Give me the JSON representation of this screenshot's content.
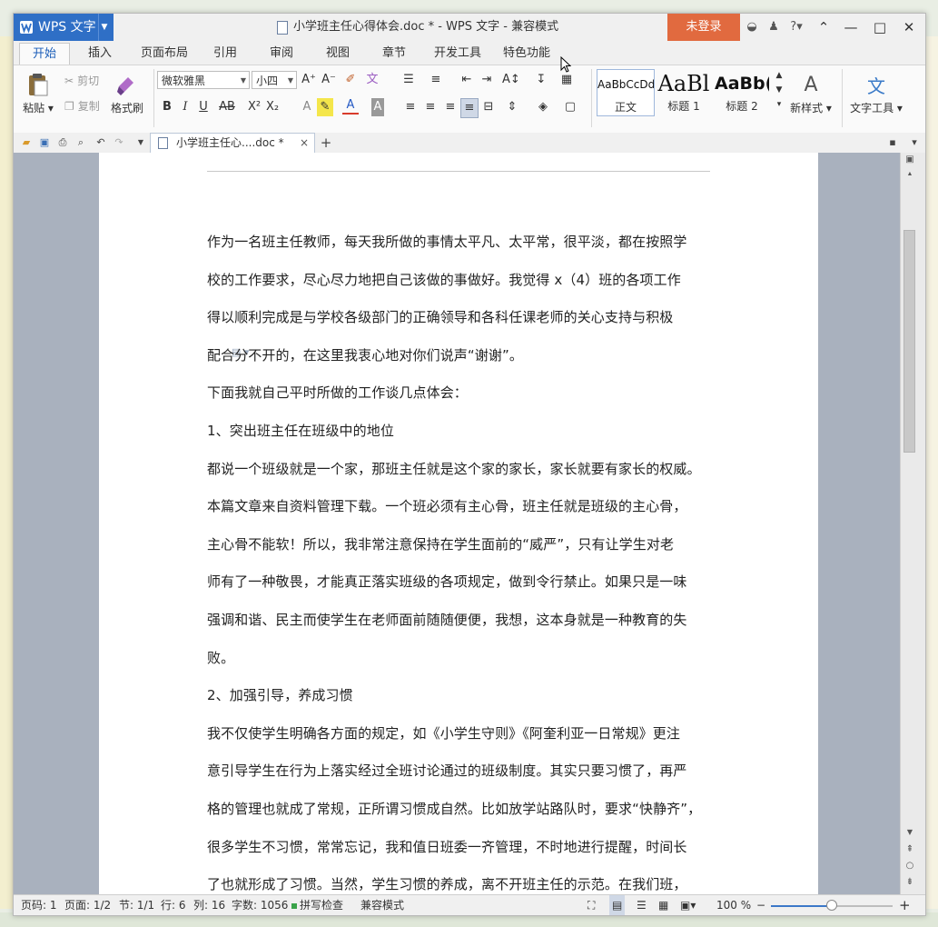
{
  "window": {
    "app_name": "WPS 文字",
    "title": "小学班主任心得体会.doc * - WPS 文字 - 兼容模式",
    "login": "未登录",
    "controls": [
      "?",
      "—",
      "□",
      "✕"
    ]
  },
  "tabs": [
    {
      "label": "开始",
      "active": true
    },
    {
      "label": "插入"
    },
    {
      "label": "页面布局"
    },
    {
      "label": "引用"
    },
    {
      "label": "审阅"
    },
    {
      "label": "视图"
    },
    {
      "label": "章节"
    },
    {
      "label": "开发工具"
    },
    {
      "label": "特色功能"
    }
  ],
  "ribbon": {
    "paste": "粘贴",
    "cut": "剪切",
    "copy": "复制",
    "format_painter": "格式刷",
    "font_name": "微软雅黑",
    "font_size": "小四",
    "styles": [
      {
        "sample": "AaBbCcDd",
        "label": "正文"
      },
      {
        "sample": "AaBl",
        "label": "标题 1"
      },
      {
        "sample": "AaBb(",
        "label": "标题 2"
      }
    ],
    "new_style": "新样式",
    "text_tools": "文字工具"
  },
  "doc_tab": {
    "label": "小学班主任心....doc *"
  },
  "document": {
    "paragraphs": [
      [
        "作为一名班主任教师，每天我所做的事情太平凡、太平常，很平淡，都在按照学",
        "校的工作要求，尽心尽力地把自己该做的事做好。我觉得 x（4）班的各项工作",
        "得以顺利完成是与学校各级部门的正确领导和各科任课老师的关心支持与积极",
        "配合分不开的，在这里我衷心地对你们说声“谢谢”。"
      ],
      [
        "下面我就自己平时所做的工作谈几点体会："
      ],
      [
        "1、突出班主任在班级中的地位"
      ],
      [
        "都说一个班级就是一个家，那班主任就是这个家的家长，家长就要有家长的权威。",
        "本篇文章来自资料管理下载。一个班必须有主心骨，班主任就是班级的主心骨，",
        "主心骨不能软！所以，我非常注意保持在学生面前的“威严”，只有让学生对老",
        "师有了一种敬畏，才能真正落实班级的各项规定，做到令行禁止。如果只是一味",
        "强调和谐、民主而使学生在老师面前随随便便，我想，这本身就是一种教育的失",
        "败。"
      ],
      [
        "2、加强引导，养成习惯"
      ],
      [
        "我不仅使学生明确各方面的规定，如《小学生守则》《阿奎利亚一日常规》更注",
        "意引导学生在行为上落实经过全班讨论通过的班级制度。其实只要习惯了，再严",
        "格的管理也就成了常规，正所谓习惯成自然。比如放学站路队时，要求“快静齐”，",
        "很多学生不习惯，常常忘记，我和值日班委一齐管理，不时地进行提醒，时间长",
        "了也就形成了习惯。当然，学生习惯的养成，离不开班主任的示范。在我们班，"
      ]
    ]
  },
  "status": {
    "page_no": "页码: 1",
    "pages": "页面: 1/2",
    "section": "节: 1/1",
    "row": "行: 6",
    "col": "列: 16",
    "words": "字数: 1056",
    "spell": "拼写检查",
    "mode": "兼容模式",
    "zoom": "100 %",
    "zoom_fraction": 0.5
  }
}
